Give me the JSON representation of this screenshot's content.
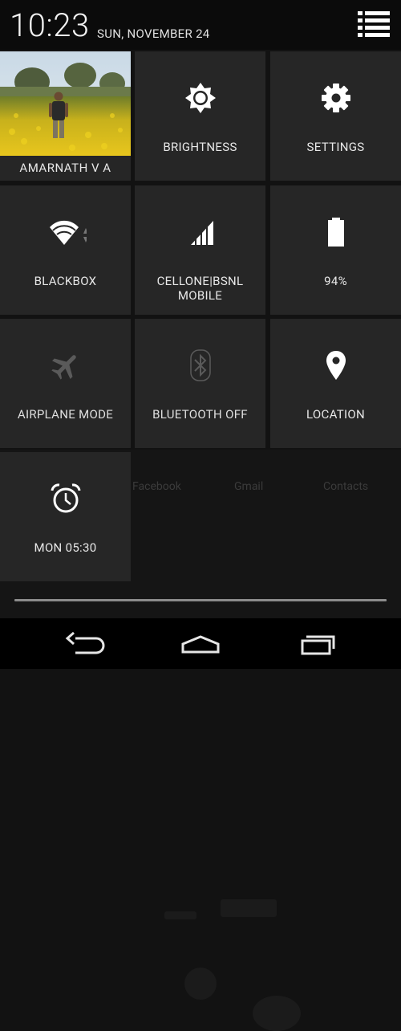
{
  "status_bar": {
    "time": "10:23",
    "date": "SUN, NOVEMBER 24"
  },
  "tiles": {
    "user": {
      "name": "AMARNATH V A"
    },
    "brightness": {
      "label": "BRIGHTNESS",
      "icon": "brightness-icon"
    },
    "settings": {
      "label": "SETTINGS",
      "icon": "gear-icon"
    },
    "wifi": {
      "label": "BLACKBOX",
      "icon": "wifi-icon"
    },
    "signal": {
      "label": "CELLONE|BSNL MOBILE",
      "icon": "signal-icon"
    },
    "battery": {
      "label": "94%",
      "icon": "battery-icon",
      "level": 0.94
    },
    "airplane": {
      "label": "AIRPLANE MODE",
      "icon": "airplane-icon",
      "enabled": false
    },
    "bluetooth": {
      "label": "BLUETOOTH OFF",
      "icon": "bluetooth-icon",
      "enabled": false
    },
    "location": {
      "label": "LOCATION",
      "icon": "location-pin-icon"
    },
    "alarm": {
      "label": "MON 05:30",
      "icon": "alarm-clock-icon"
    }
  },
  "background": {
    "apps": [
      "Facebook",
      "Gmail",
      "Contacts"
    ]
  },
  "nav_bar": {
    "back": "back-icon",
    "home": "home-icon",
    "recents": "recents-icon"
  },
  "colors": {
    "tile_bg": "#262626",
    "screen_bg": "#121212",
    "icon_white": "#ffffff",
    "icon_dim": "#5a5a5a"
  }
}
